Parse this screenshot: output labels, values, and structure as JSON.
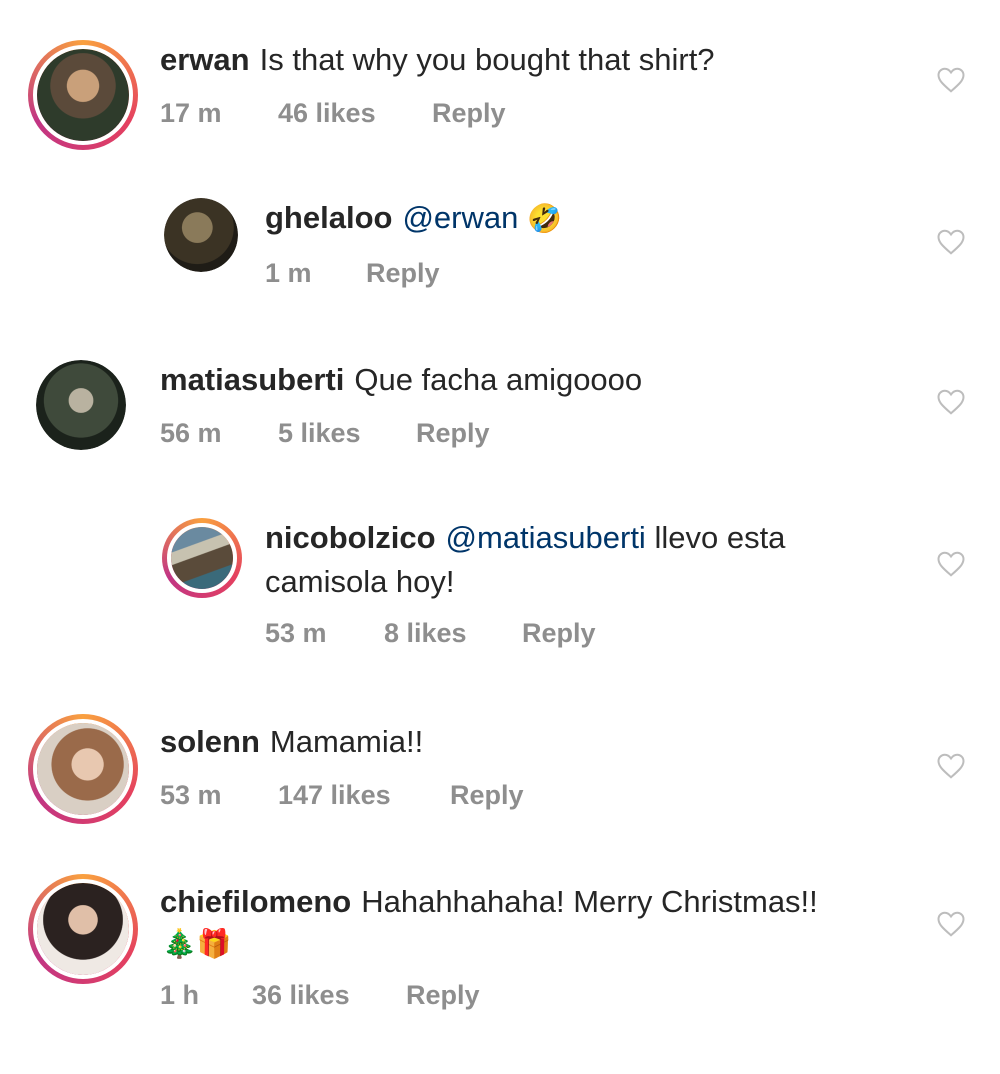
{
  "comments": [
    {
      "user": "erwan",
      "text": "Is that why you bought that shirt?",
      "time": "17 m",
      "likes": "46 likes",
      "reply": "Reply"
    },
    {
      "user": "ghelaloo",
      "mention": "@erwan",
      "emoji": "🤣",
      "time": "1 m",
      "reply": "Reply"
    },
    {
      "user": "matiasuberti",
      "text": "Que facha amigoooo",
      "time": "56 m",
      "likes": "5 likes",
      "reply": "Reply"
    },
    {
      "user": "nicobolzico",
      "mention": "@matiasuberti",
      "text": "llevo esta",
      "text2": "camisola hoy!",
      "time": "53 m",
      "likes": "8 likes",
      "reply": "Reply"
    },
    {
      "user": "solenn",
      "text": "Mamamia!!",
      "time": "53 m",
      "likes": "147 likes",
      "reply": "Reply"
    },
    {
      "user": "chiefilomeno",
      "text": "Hahahhahaha! Merry Christmas!!",
      "emoji": "🎄🎁",
      "time": "1 h",
      "likes": "36 likes",
      "reply": "Reply"
    }
  ],
  "colors": {
    "text": "#262626",
    "meta": "#8e8e8e",
    "mention": "#003569",
    "ring": "#e4405f"
  },
  "icons": {
    "like": "heart-outline-icon"
  }
}
